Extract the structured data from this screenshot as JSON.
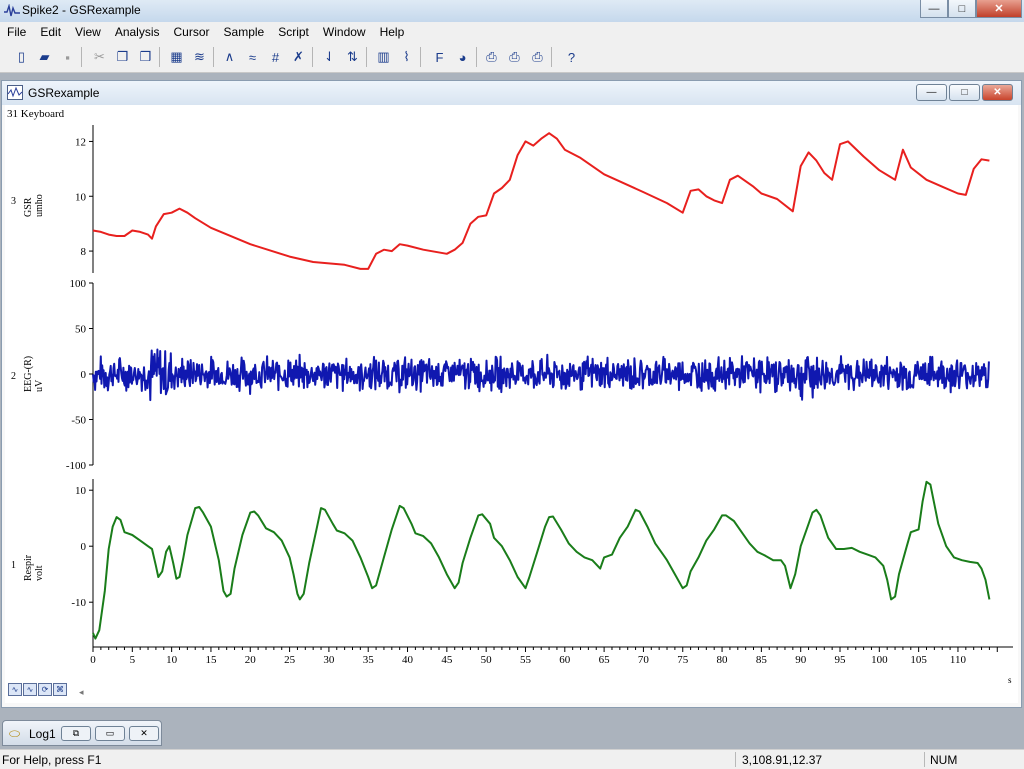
{
  "window": {
    "title": "Spike2 - GSRexample",
    "min_label": "—",
    "max_label": "□",
    "close_label": "✕"
  },
  "menu": [
    "File",
    "Edit",
    "View",
    "Analysis",
    "Cursor",
    "Sample",
    "Script",
    "Window",
    "Help"
  ],
  "toolbar": {
    "group1": [
      {
        "icon": "new-file-icon",
        "glyph": "▯"
      },
      {
        "icon": "open-folder-icon",
        "glyph": "▰"
      },
      {
        "icon": "save-icon",
        "glyph": "▪"
      }
    ],
    "group2": [
      {
        "icon": "cut-icon",
        "glyph": "✂"
      },
      {
        "icon": "copy-icon",
        "glyph": "❐"
      },
      {
        "icon": "paste-icon",
        "glyph": "❒"
      }
    ],
    "group3": [
      {
        "icon": "xy-view-icon",
        "glyph": "▦"
      },
      {
        "icon": "channel-display-icon",
        "glyph": "≋"
      }
    ],
    "group4": [
      {
        "icon": "waveform-icon",
        "glyph": "∧"
      },
      {
        "icon": "waveform-overlay-icon",
        "glyph": "≈"
      },
      {
        "icon": "grid-icon",
        "glyph": "#"
      },
      {
        "icon": "remove-waveform-icon",
        "glyph": "✗"
      }
    ],
    "group5": [
      {
        "icon": "cursor-down-icon",
        "glyph": "⇃"
      },
      {
        "icon": "cursor-updown-icon",
        "glyph": "⇅"
      }
    ],
    "group6": [
      {
        "icon": "histogram-icon",
        "glyph": "▥"
      },
      {
        "icon": "analysis-graph-icon",
        "glyph": "⌇"
      }
    ],
    "group7": [
      {
        "icon": "font-icon",
        "glyph": "F"
      },
      {
        "icon": "color-palette-icon",
        "glyph": "◕"
      }
    ],
    "group8": [
      {
        "icon": "print-icon",
        "glyph": "⎙"
      },
      {
        "icon": "print-visible-icon",
        "glyph": "⎙"
      },
      {
        "icon": "print-screen-icon",
        "glyph": "⎙"
      }
    ],
    "group9": [
      {
        "icon": "help-icon",
        "glyph": "?"
      }
    ]
  },
  "child_window": {
    "title": "GSRexample",
    "min_label": "—",
    "max_label": "□",
    "close_label": "✕",
    "keyboard_label": "31 Keyboard",
    "xaxis_unit": "s"
  },
  "tiny_buttons": [
    "∿",
    "∿",
    "⟳",
    "⌘"
  ],
  "chart_data": {
    "type": "line",
    "x": {
      "range": [
        0,
        117
      ],
      "ticks": [
        0,
        5,
        10,
        15,
        20,
        25,
        30,
        35,
        40,
        45,
        50,
        55,
        60,
        65,
        70,
        75,
        80,
        85,
        90,
        95,
        100,
        105,
        110
      ],
      "unit": "s"
    },
    "channels": [
      {
        "number": "3",
        "name": "GSR",
        "unit": "umho",
        "color": "#e8201e",
        "ylim": [
          7.2,
          12.6
        ],
        "yticks": [
          8,
          10,
          12
        ],
        "points": [
          [
            0,
            8.75
          ],
          [
            1,
            8.7
          ],
          [
            2,
            8.6
          ],
          [
            3,
            8.55
          ],
          [
            4,
            8.55
          ],
          [
            5,
            8.75
          ],
          [
            6,
            8.7
          ],
          [
            7,
            8.6
          ],
          [
            7.5,
            8.45
          ],
          [
            8,
            8.9
          ],
          [
            9,
            9.35
          ],
          [
            10,
            9.4
          ],
          [
            11,
            9.55
          ],
          [
            12,
            9.4
          ],
          [
            13,
            9.2
          ],
          [
            15,
            8.85
          ],
          [
            20,
            8.25
          ],
          [
            25,
            7.8
          ],
          [
            28,
            7.6
          ],
          [
            30,
            7.55
          ],
          [
            32,
            7.5
          ],
          [
            34,
            7.35
          ],
          [
            35,
            7.35
          ],
          [
            36,
            7.9
          ],
          [
            37,
            8.05
          ],
          [
            38,
            8.0
          ],
          [
            39,
            8.25
          ],
          [
            40,
            8.2
          ],
          [
            42,
            8.05
          ],
          [
            45,
            7.9
          ],
          [
            46,
            8.05
          ],
          [
            47,
            8.3
          ],
          [
            48,
            9.0
          ],
          [
            49,
            9.25
          ],
          [
            50,
            9.3
          ],
          [
            51,
            10.1
          ],
          [
            52,
            10.3
          ],
          [
            53,
            10.6
          ],
          [
            54,
            11.5
          ],
          [
            55,
            12.0
          ],
          [
            56,
            11.85
          ],
          [
            57,
            12.1
          ],
          [
            58,
            12.3
          ],
          [
            59,
            12.1
          ],
          [
            60,
            11.7
          ],
          [
            62,
            11.4
          ],
          [
            65,
            10.8
          ],
          [
            70,
            10.15
          ],
          [
            73,
            9.75
          ],
          [
            75,
            9.4
          ],
          [
            76,
            10.2
          ],
          [
            77,
            10.25
          ],
          [
            78,
            10.0
          ],
          [
            79,
            9.85
          ],
          [
            80,
            9.75
          ],
          [
            81,
            10.6
          ],
          [
            82,
            10.75
          ],
          [
            84,
            10.35
          ],
          [
            85,
            10.1
          ],
          [
            87,
            9.9
          ],
          [
            89,
            9.45
          ],
          [
            90,
            11.1
          ],
          [
            91,
            11.6
          ],
          [
            92,
            11.3
          ],
          [
            93,
            10.85
          ],
          [
            94,
            10.6
          ],
          [
            95,
            11.9
          ],
          [
            96,
            12.0
          ],
          [
            98,
            11.45
          ],
          [
            100,
            10.95
          ],
          [
            102,
            10.6
          ],
          [
            103,
            11.7
          ],
          [
            104,
            11.05
          ],
          [
            106,
            10.6
          ],
          [
            108,
            10.35
          ],
          [
            110,
            10.1
          ],
          [
            111,
            10.05
          ],
          [
            112,
            11.0
          ],
          [
            113,
            11.35
          ],
          [
            114,
            11.3
          ]
        ]
      },
      {
        "number": "2",
        "name": "EEG-(R)",
        "unit": "uV",
        "color": "#1018b0",
        "ylim": [
          -100,
          100
        ],
        "yticks": [
          -100,
          -50,
          0,
          50,
          100
        ],
        "noise_amplitude": 15,
        "baseline": 0
      },
      {
        "number": "1",
        "name": "Respir",
        "unit": "volt",
        "color": "#1a7d1a",
        "ylim": [
          -18,
          12
        ],
        "yticks": [
          -10,
          0,
          10
        ],
        "points": [
          [
            0,
            -15.5
          ],
          [
            0.3,
            -16.5
          ],
          [
            0.8,
            -15
          ],
          [
            1.5,
            -8
          ],
          [
            2,
            -0.5
          ],
          [
            2.5,
            3.5
          ],
          [
            3,
            5.2
          ],
          [
            3.5,
            4.7
          ],
          [
            4,
            2.5
          ],
          [
            5,
            2.0
          ],
          [
            6,
            1.0
          ],
          [
            7,
            0.0
          ],
          [
            7.5,
            -0.5
          ],
          [
            8,
            -3.5
          ],
          [
            8.3,
            -5.5
          ],
          [
            8.8,
            -4.5
          ],
          [
            9.3,
            -1.0
          ],
          [
            9.7,
            0.0
          ],
          [
            10.2,
            -3.0
          ],
          [
            10.6,
            -5.8
          ],
          [
            11,
            -5.5
          ],
          [
            11.5,
            -2.0
          ],
          [
            12,
            2.0
          ],
          [
            13,
            6.8
          ],
          [
            13.5,
            7.0
          ],
          [
            14,
            6.0
          ],
          [
            15,
            3.5
          ],
          [
            16,
            -2.5
          ],
          [
            16.6,
            -8.0
          ],
          [
            17,
            -9.0
          ],
          [
            17.5,
            -8.5
          ],
          [
            18,
            -4.0
          ],
          [
            19,
            2.0
          ],
          [
            20,
            6.0
          ],
          [
            20.5,
            6.2
          ],
          [
            21,
            5.5
          ],
          [
            22,
            3.2
          ],
          [
            23,
            2.5
          ],
          [
            24,
            1.0
          ],
          [
            25,
            -2.0
          ],
          [
            25.5,
            -5.0
          ],
          [
            26,
            -8.5
          ],
          [
            26.3,
            -9.5
          ],
          [
            26.8,
            -8.5
          ],
          [
            27.5,
            -3.0
          ],
          [
            28.5,
            3.5
          ],
          [
            29,
            6.8
          ],
          [
            29.5,
            6.5
          ],
          [
            30.5,
            4.0
          ],
          [
            31,
            2.8
          ],
          [
            32,
            2.3
          ],
          [
            33,
            1.0
          ],
          [
            34,
            -2.0
          ],
          [
            35,
            -5.5
          ],
          [
            35.5,
            -7.5
          ],
          [
            36,
            -7.0
          ],
          [
            37,
            -2.0
          ],
          [
            38,
            3.0
          ],
          [
            39,
            7.2
          ],
          [
            39.5,
            6.8
          ],
          [
            40.5,
            4.0
          ],
          [
            41,
            2.3
          ],
          [
            42,
            1.8
          ],
          [
            43,
            0.5
          ],
          [
            44,
            -2.0
          ],
          [
            45,
            -5.0
          ],
          [
            46,
            -7.5
          ],
          [
            46.5,
            -6.5
          ],
          [
            47,
            -3.0
          ],
          [
            48,
            1.5
          ],
          [
            49,
            5.5
          ],
          [
            49.5,
            5.7
          ],
          [
            50.5,
            4.0
          ],
          [
            51,
            1.5
          ],
          [
            52,
            0.0
          ],
          [
            53,
            -2.5
          ],
          [
            54,
            -5.5
          ],
          [
            55,
            -7.5
          ],
          [
            55.5,
            -5.5
          ],
          [
            56.5,
            -1.0
          ],
          [
            57.5,
            3.5
          ],
          [
            58,
            5.2
          ],
          [
            58.5,
            5.3
          ],
          [
            59.5,
            3.0
          ],
          [
            60.5,
            0.5
          ],
          [
            61.5,
            -1.0
          ],
          [
            62.5,
            -2.0
          ],
          [
            63.5,
            -2.5
          ],
          [
            64.5,
            -4.0
          ],
          [
            65,
            -2.0
          ],
          [
            66,
            -1.5
          ],
          [
            67,
            1.5
          ],
          [
            68,
            3.5
          ],
          [
            69,
            6.5
          ],
          [
            69.5,
            6.2
          ],
          [
            70.5,
            3.5
          ],
          [
            71.5,
            0.5
          ],
          [
            72.5,
            -1.5
          ],
          [
            73,
            -2.5
          ],
          [
            74,
            -5.0
          ],
          [
            75,
            -7.5
          ],
          [
            75.5,
            -7.0
          ],
          [
            76,
            -4.5
          ],
          [
            77,
            -2.0
          ],
          [
            78,
            1.0
          ],
          [
            79,
            3.0
          ],
          [
            80,
            5.5
          ],
          [
            80.5,
            5.5
          ],
          [
            81.5,
            4.5
          ],
          [
            82.5,
            2.5
          ],
          [
            83.5,
            0.5
          ],
          [
            84.5,
            -1.0
          ],
          [
            85.5,
            -1.7
          ],
          [
            86.5,
            -2.5
          ],
          [
            87.5,
            -2.5
          ],
          [
            88,
            -3.5
          ],
          [
            88.7,
            -7.5
          ],
          [
            89.3,
            -5.0
          ],
          [
            90,
            0.0
          ],
          [
            91,
            4.0
          ],
          [
            91.5,
            6.0
          ],
          [
            92,
            6.5
          ],
          [
            92.5,
            5.5
          ],
          [
            93.5,
            1.5
          ],
          [
            94.5,
            -0.5
          ],
          [
            95.5,
            -0.5
          ],
          [
            96.5,
            -0.3
          ],
          [
            97.5,
            -1.0
          ],
          [
            98.5,
            -1.5
          ],
          [
            99.5,
            -2.0
          ],
          [
            100.5,
            -3.5
          ],
          [
            101,
            -6.0
          ],
          [
            101.5,
            -9.5
          ],
          [
            102,
            -9.0
          ],
          [
            102.5,
            -5.0
          ],
          [
            103.5,
            0.0
          ],
          [
            104,
            2.5
          ],
          [
            105,
            3.0
          ],
          [
            105.5,
            8.0
          ],
          [
            106,
            11.5
          ],
          [
            106.5,
            11.0
          ],
          [
            107.5,
            4.0
          ],
          [
            108.5,
            0.0
          ],
          [
            109.5,
            -2.0
          ],
          [
            110.5,
            -2.5
          ],
          [
            111.5,
            -2.8
          ],
          [
            112.5,
            -3.0
          ],
          [
            113,
            -4.0
          ],
          [
            113.5,
            -6.0
          ],
          [
            114,
            -9.5
          ]
        ]
      }
    ]
  },
  "log_tab": {
    "label": "Log1"
  },
  "status": {
    "help_text": "For Help, press F1",
    "coords": "3,108.91,12.37",
    "num": "NUM"
  }
}
